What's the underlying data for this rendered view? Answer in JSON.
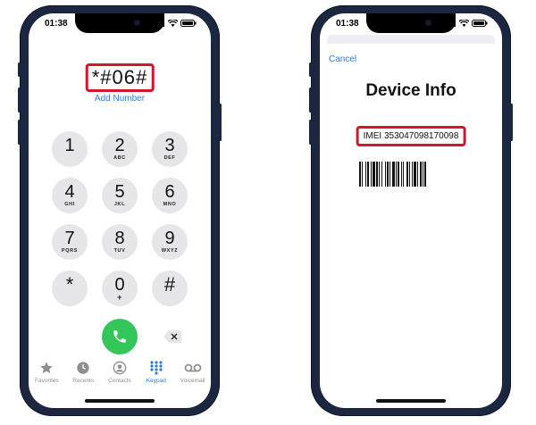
{
  "left_phone": {
    "status": {
      "time": "01:38"
    },
    "dialed": "*#06#",
    "add_number": "Add Number",
    "keys": [
      {
        "digit": "1",
        "letters": ""
      },
      {
        "digit": "2",
        "letters": "ABC"
      },
      {
        "digit": "3",
        "letters": "DEF"
      },
      {
        "digit": "4",
        "letters": "GHI"
      },
      {
        "digit": "5",
        "letters": "JKL"
      },
      {
        "digit": "6",
        "letters": "MNO"
      },
      {
        "digit": "7",
        "letters": "PQRS"
      },
      {
        "digit": "8",
        "letters": "TUV"
      },
      {
        "digit": "9",
        "letters": "WXYZ"
      },
      {
        "digit": "*",
        "letters": ""
      },
      {
        "digit": "0",
        "letters": "+"
      },
      {
        "digit": "#",
        "letters": ""
      }
    ],
    "tabs": [
      {
        "label": "Favorites",
        "icon": "star-icon"
      },
      {
        "label": "Recents",
        "icon": "clock-icon"
      },
      {
        "label": "Contacts",
        "icon": "person-icon"
      },
      {
        "label": "Keypad",
        "icon": "keypad-icon"
      },
      {
        "label": "Voicemail",
        "icon": "voicemail-icon"
      }
    ],
    "active_tab": "Keypad"
  },
  "right_phone": {
    "status": {
      "time": "01:38"
    },
    "cancel": "Cancel",
    "title": "Device Info",
    "imei": "IMEI 353047098170098"
  },
  "colors": {
    "frame": "#1b2640",
    "highlight": "#d2162e",
    "link": "#2f7ad9",
    "call": "#33c759",
    "key_bg": "#e6e6e8"
  }
}
